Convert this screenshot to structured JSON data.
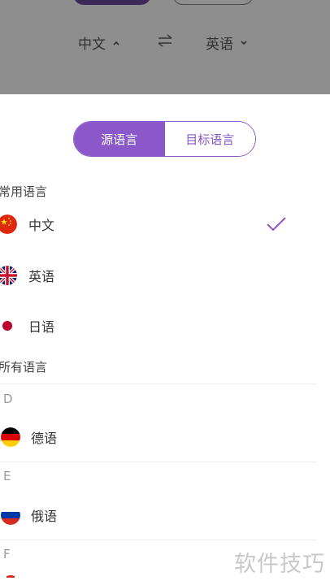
{
  "header": {
    "source_language": "中文",
    "target_language": "英语"
  },
  "toggle": {
    "source_label": "源语言",
    "target_label": "目标语言"
  },
  "common": {
    "title": "常用语言",
    "items": [
      {
        "label": "中文",
        "flag": "china-flag-icon",
        "selected": true
      },
      {
        "label": "英语",
        "flag": "uk-flag-icon",
        "selected": false
      },
      {
        "label": "日语",
        "flag": "japan-flag-icon",
        "selected": false
      }
    ]
  },
  "all": {
    "title": "所有语言",
    "groups": [
      {
        "letter": "D",
        "items": [
          {
            "label": "德语",
            "flag": "germany-flag-icon"
          }
        ]
      },
      {
        "letter": "E",
        "items": [
          {
            "label": "俄语",
            "flag": "russia-flag-icon"
          }
        ]
      },
      {
        "letter": "F",
        "items": []
      }
    ]
  },
  "watermark": "软件技巧",
  "colors": {
    "accent": "#8a58c8",
    "backdrop": "#8e8e8e"
  }
}
